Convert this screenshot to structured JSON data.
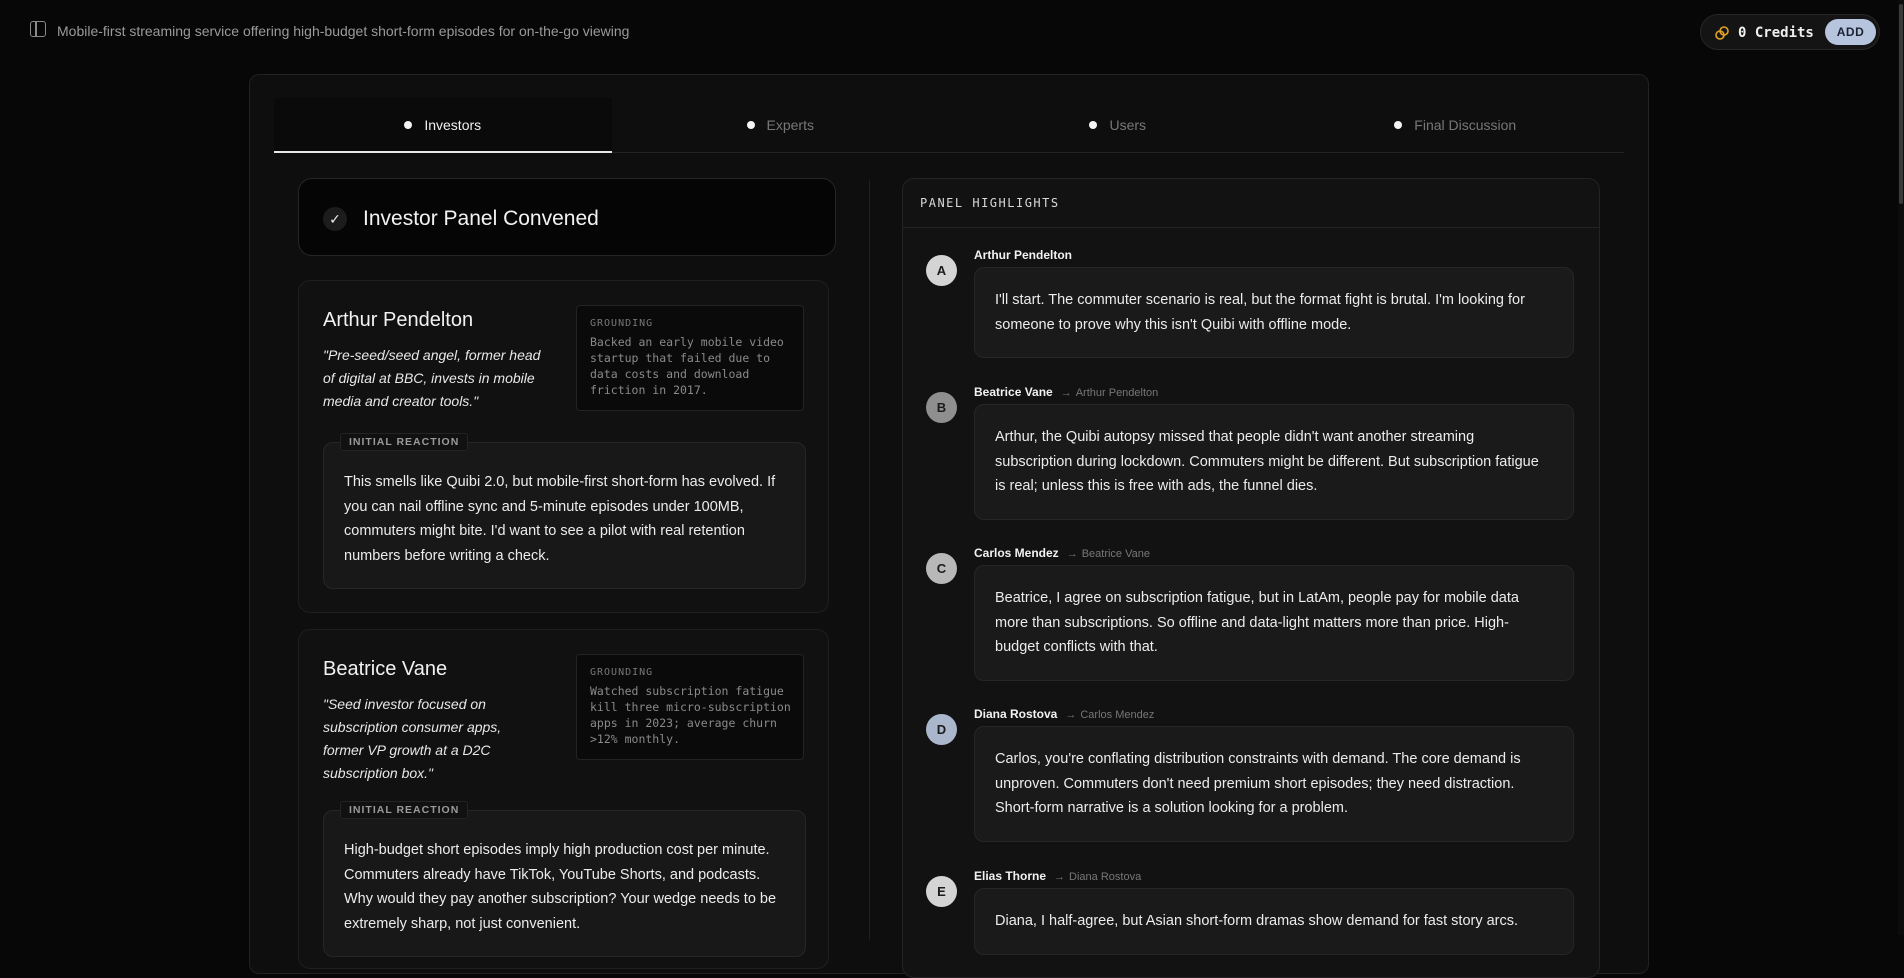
{
  "header": {
    "title": "Mobile-first streaming service offering high-budget short-form episodes for on-the-go viewing",
    "credits_label": "0 Credits",
    "add_label": "ADD"
  },
  "tabs": [
    {
      "label": "Investors",
      "active": true
    },
    {
      "label": "Experts",
      "active": false
    },
    {
      "label": "Users",
      "active": false
    },
    {
      "label": "Final Discussion",
      "active": false
    }
  ],
  "convened": {
    "title": "Investor Panel Convened"
  },
  "personas": [
    {
      "name": "Arthur Pendelton",
      "bio": "\"Pre-seed/seed angel, former head of digital at BBC, invests in mobile media and creator tools.\"",
      "grounding_label": "GROUNDING",
      "grounding": "Backed an early mobile video startup that failed due to data costs and download friction in 2017.",
      "reaction_label": "INITIAL REACTION",
      "reaction": "This smells like Quibi 2.0, but mobile-first short-form has evolved. If you can nail offline sync and 5-minute episodes under 100MB, commuters might bite. I'd want to see a pilot with real retention numbers before writing a check."
    },
    {
      "name": "Beatrice Vane",
      "bio": "\"Seed investor focused on subscription consumer apps, former VP growth at a D2C subscription box.\"",
      "grounding_label": "GROUNDING",
      "grounding": "Watched subscription fatigue kill three micro-subscription apps in 2023; average churn >12% monthly.",
      "reaction_label": "INITIAL REACTION",
      "reaction": "High-budget short episodes imply high production cost per minute. Commuters already have TikTok, YouTube Shorts, and podcasts. Why would they pay another subscription? Your wedge needs to be extremely sharp, not just convenient."
    }
  ],
  "highlights": {
    "title": "PANEL HIGHLIGHTS",
    "messages": [
      {
        "initial": "A",
        "author": "Arthur Pendelton",
        "reply_to": "",
        "color": "#d4d4d4",
        "text": "I'll start. The commuter scenario is real, but the format fight is brutal. I'm looking for someone to prove why this isn't Quibi with offline mode."
      },
      {
        "initial": "B",
        "author": "Beatrice Vane",
        "reply_to": "Arthur Pendelton",
        "color": "#8f8f8f",
        "text": "Arthur, the Quibi autopsy missed that people didn't want another streaming subscription during lockdown. Commuters might be different. But subscription fatigue is real; unless this is free with ads, the funnel dies."
      },
      {
        "initial": "C",
        "author": "Carlos Mendez",
        "reply_to": "Beatrice Vane",
        "color": "#b8b8b8",
        "text": "Beatrice, I agree on subscription fatigue, but in LatAm, people pay for mobile data more than subscriptions. So offline and data-light matters more than price. High-budget conflicts with that."
      },
      {
        "initial": "D",
        "author": "Diana Rostova",
        "reply_to": "Carlos Mendez",
        "color": "#a9b6cc",
        "text": "Carlos, you're conflating distribution constraints with demand. The core demand is unproven. Commuters don't need premium short episodes; they need distraction. Short-form narrative is a solution looking for a problem."
      },
      {
        "initial": "E",
        "author": "Elias Thorne",
        "reply_to": "Diana Rostova",
        "color": "#d4d4d4",
        "text": "Diana, I half-agree, but Asian short-form dramas show demand for fast story arcs."
      }
    ]
  },
  "colors": {
    "accent": "#b6c5dd",
    "background": "#070707"
  }
}
